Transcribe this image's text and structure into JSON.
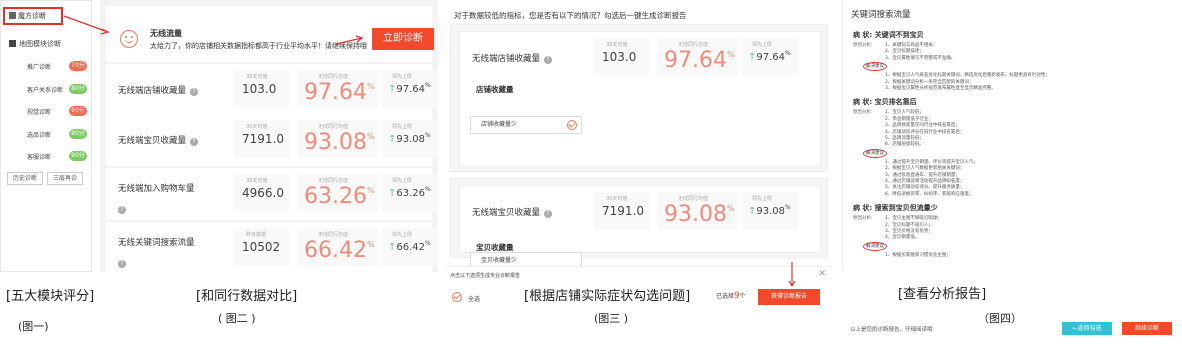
{
  "panel1": {
    "top_item": "魔方诊断",
    "section_title": "地图模块诊断",
    "modules": [
      {
        "label": "推广诊断",
        "badge": "70分",
        "color": "#f26b4f"
      },
      {
        "label": "客户关系诊断",
        "badge": "80分",
        "color": "#7ccc64"
      },
      {
        "label": "视觉诊断",
        "badge": "60分",
        "color": "#f26b4f"
      },
      {
        "label": "选品诊断",
        "badge": "80分",
        "color": "#7ccc64"
      },
      {
        "label": "客服诊断",
        "badge": "90分",
        "color": "#7ccc64"
      }
    ],
    "buttons": [
      "历史诊断",
      "三层再诊"
    ],
    "caption": "[五大模块评分]",
    "figure": "(图一)"
  },
  "panel2": {
    "title": "无线流量",
    "subtitle": "太给力了，你的店铺相关数据指标都高于行业平均水平！请继续保持哦",
    "diagnose_button": "立即诊断",
    "col_captions": [
      "30天均值",
      "无线同行均值",
      "领先上限"
    ],
    "rows": [
      {
        "label": "无线端店铺收藏量",
        "value": "103.0",
        "pct": "97.64",
        "up": "97.64",
        "cap1": "30天均值",
        "cap2": "无线同行均值",
        "cap3": "领先上限"
      },
      {
        "label": "无线端宝贝收藏量",
        "value": "7191.0",
        "pct": "93.08",
        "up": "93.08",
        "cap1": "30天均值",
        "cap2": "无线同行均值",
        "cap3": "领先上限"
      },
      {
        "label": "无线端加入购物车量",
        "value": "4966.0",
        "pct": "63.26",
        "up": "63.26",
        "cap1": "30天均值",
        "cap2": "无线同行均值",
        "cap3": "领先上限"
      },
      {
        "label": "无线关键词搜索流量",
        "value": "10502",
        "pct": "66.42",
        "up": "66.42",
        "cap1": "昨日数据",
        "cap2": "无线同行均值",
        "cap3": "领先上限"
      }
    ],
    "caption": "[和同行数据对比]",
    "figure": "( 图二 )"
  },
  "panel3": {
    "question": "对于数据较低的指标，您是否有以下的情况？勾选后一键生成诊断报告",
    "metrics": [
      {
        "label": "无线端店铺收藏量",
        "value": "103.0",
        "pct": "97.64",
        "up": "97.64",
        "section": "店铺收藏量",
        "option": "店铺收藏量少",
        "cap1": "30天均值",
        "cap2": "无线同行均值",
        "cap3": "领先上限"
      },
      {
        "label": "无线端宝贝收藏量",
        "value": "7191.0",
        "pct": "93.08",
        "up": "93.08",
        "section": "宝贝收藏量",
        "option": "宝贝收藏量少",
        "cap1": "30天均值",
        "cap2": "无线同行均值",
        "cap3": "领先上限"
      }
    ],
    "bottom_tip": "点击以下选项生成专业诊断报告",
    "select_all": "全选",
    "selected_prefix": "已选择",
    "selected_count": "9",
    "selected_unit": "个",
    "report_button": "获得诊断报告",
    "caption": "[根据店铺实际症状勾选问题]",
    "figure": "(图三 )"
  },
  "panel4": {
    "heading": "关键词搜索流量",
    "symptoms": [
      {
        "title": "病 状:  关键词不到宝贝",
        "analysis": "原因分析:",
        "items": [
          "1、关键词与商品不相关；",
          "2、宝贝标题描述；",
          "3、宝贝属性填写不完整或不准确。"
        ],
        "solution_items": [
          "1、根据宝贝人气排名优化标题关键词，精选优化后重新发布，标题更具有针对性；",
          "2、根据关键词分析一条完全匹配的关键词；",
          "3、根据宝贝属性分析规范发布属性直至显示精准完整。"
        ]
      },
      {
        "title": "病 状:  宝贝排名靠后",
        "analysis": "原因分析:",
        "items": [
          "1、宝贝人气较低；",
          "2、单品销量低于行业；",
          "3、品牌搜索量在同行业中排名靠后；",
          "4、店铺动态评分在同行业中排名靠后；",
          "5、品牌流量较低；",
          "6、店铺层级较低。"
        ],
        "solution_items": [
          "1、通过提升宝贝销量、评价等提升宝贝人气；",
          "2、根据宝贝人气数据更新相关关键词；",
          "3、通过投放直通车、提升店铺销量；",
          "4、通过店铺促销活动提升品牌知名度；",
          "5、关注店铺动态评分、提升服务质量；",
          "6、降低退换货率、纠纷率、客服响应速度。"
        ]
      },
      {
        "title": "病 状:  搜索到宝贝但流量少",
        "analysis": "原因分析:",
        "items": [
          "1、宝贝主图不够吸引眼球；",
          "2、宝贝标题不吸引人；",
          "3、宝贝价格没有优势；",
          "4、宝贝销量低。"
        ],
        "solution_items": [
          "1、根据买家搜索习惯优化主图；"
        ]
      }
    ],
    "solution_label": "解决建议",
    "footer_text": "以上是您的诊断报告，仔细阅读哦",
    "btn_back": "←返回勾选",
    "btn_go": "继续诊断",
    "caption": "[查看分析报告]",
    "figure": "（图四）"
  }
}
